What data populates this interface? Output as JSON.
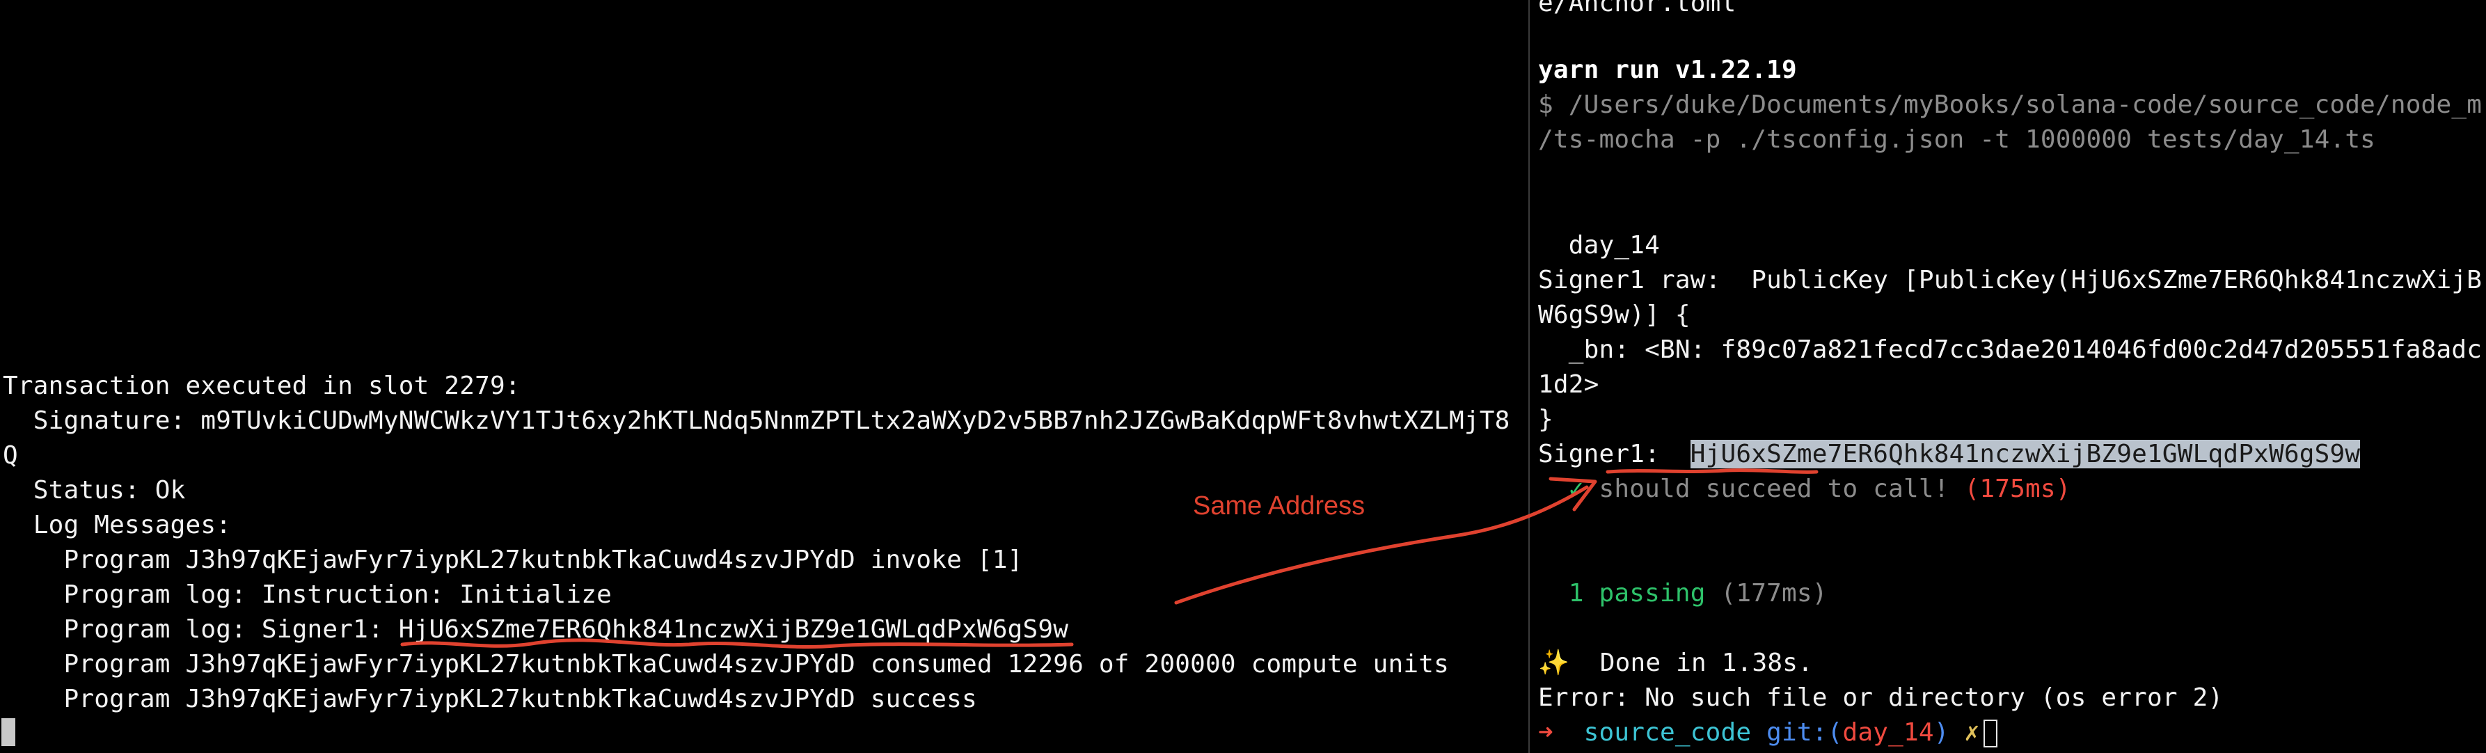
{
  "left_terminal": {
    "lines": [
      "Transaction executed in slot 2279:",
      "  Signature: m9TUvkiCUDwMyNWCWkzVY1TJt6xy2hKTLNdq5NnmZPTLtx2aWXyD2v5BB7nh2JZGwBaKdqpWFt8vhwtXZLMjT8",
      "Q",
      "  Status: Ok",
      "  Log Messages:",
      "    Program J3h97qKEjawFyr7iypKL27kutnbkTkaCuwd4szvJPYdD invoke [1]",
      "    Program log: Instruction: Initialize",
      "    Program log: Signer1: HjU6xSZme7ER6Qhk841nczwXijBZ9e1GWLqdPxW6gS9w",
      "    Program J3h97qKEjawFyr7iypKL27kutnbkTkaCuwd4szvJPYdD consumed 12296 of 200000 compute units",
      "    Program J3h97qKEjawFyr7iypKL27kutnbkTkaCuwd4szvJPYdD success"
    ]
  },
  "right_terminal": {
    "top_partial": "e/Anchor.toml",
    "yarn_header": "yarn run v1.22.19",
    "command_line1": "$ /Users/duke/Documents/myBooks/solana-code/source_code/node_m",
    "command_line2": "/ts-mocha -p ./tsconfig.json -t 1000000 tests/day_14.ts",
    "suite_name": "  day_14",
    "signer_raw_line1": "Signer1 raw:  PublicKey [PublicKey(HjU6xSZme7ER6Qhk841nczwXijB",
    "signer_raw_line2": "W6gS9w)] {",
    "bn_line1": "  _bn: <BN: f89c07a821fecd7cc3dae2014046fd00c2d47d205551fa8adc",
    "bn_line2": "1d2>",
    "close_brace": "}",
    "signer1_label": "Signer1:  ",
    "signer1_value": "HjU6xSZme7ER6Qhk841nczwXijBZ9e1GWLqdPxW6gS9w",
    "test_check": "  ✓",
    "test_name": " should succeed to call!",
    "test_time": " (175ms)",
    "passing_count": "  1 passing",
    "passing_time": " (177ms)",
    "done_icon": "✨",
    "done_text": "  Done in 1.38s.",
    "error_text": "Error: No such file or directory (os error 2)",
    "prompt_arrow": "➜",
    "prompt_dir": "  source_code",
    "prompt_git": " git:(",
    "prompt_branch": "day_14",
    "prompt_git_close": ")",
    "prompt_dirty": " ✗"
  },
  "annotation": {
    "label": "Same Address"
  },
  "colors": {
    "background": "#000000",
    "annotation_red": "#e0422f",
    "selection": "#b9c2cc",
    "prompt_arrow": "#f04a3f",
    "prompt_dir": "#3dc4d4",
    "git_label": "#4d8cf0"
  }
}
